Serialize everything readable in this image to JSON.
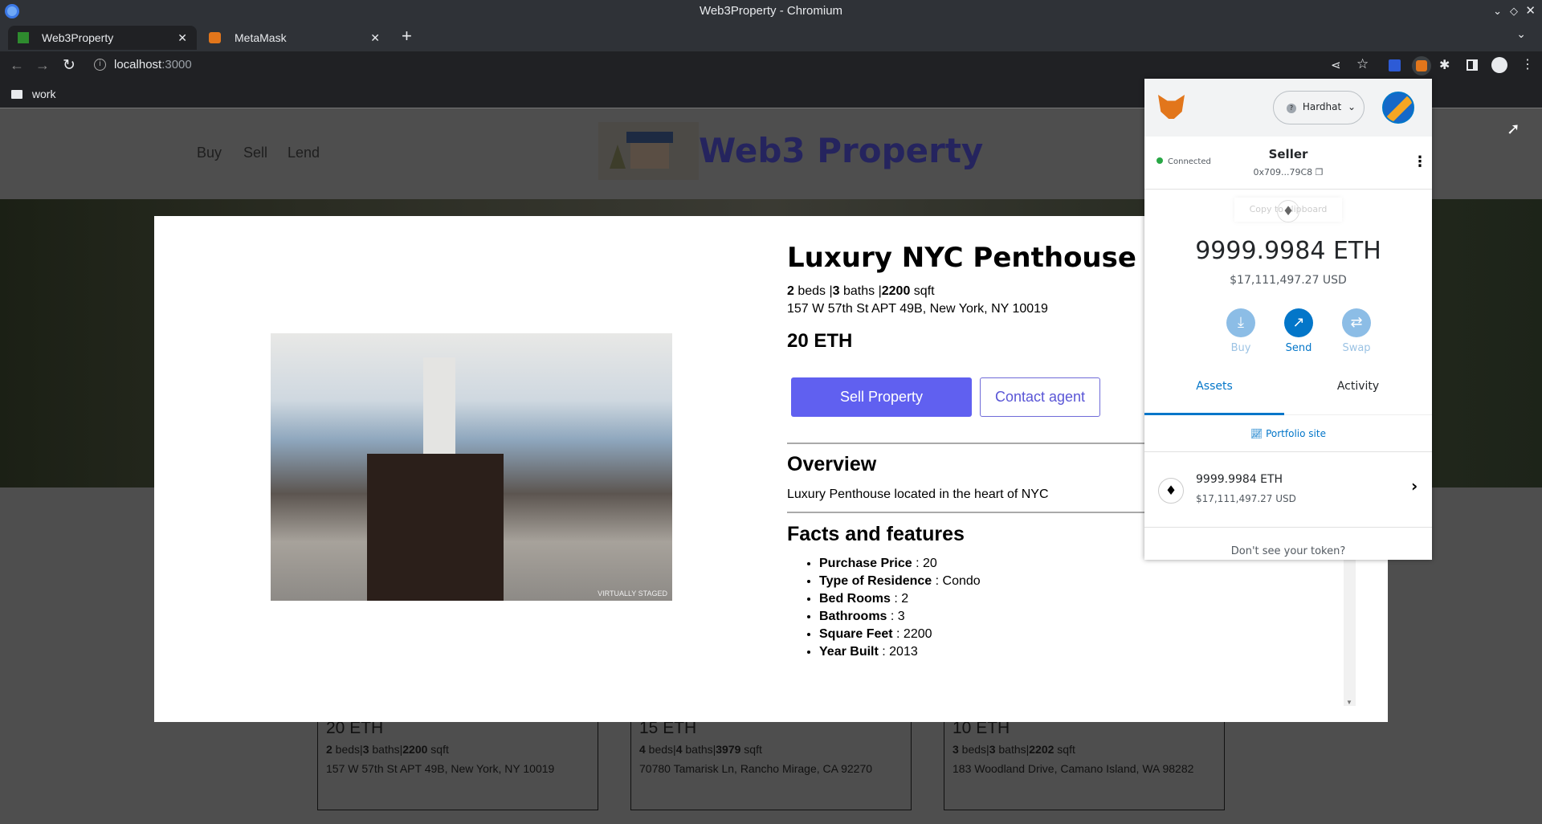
{
  "window_title": "Web3Property - Chromium",
  "tabs": [
    {
      "label": "Web3Property",
      "active": true
    },
    {
      "label": "MetaMask",
      "active": false
    }
  ],
  "address": {
    "host": "localhost",
    "port": ":3000"
  },
  "bookmarks": [
    {
      "label": "work"
    }
  ],
  "nav": {
    "links": [
      "Buy",
      "Sell",
      "Lend"
    ],
    "brand": "Web3 Property",
    "brand_color": "#2b2a80"
  },
  "modal": {
    "title": "Luxury NYC Penthouse",
    "beds": "2",
    "baths": "3",
    "sqft": "2200",
    "beds_label": " beds |",
    "baths_label": " baths |",
    "sqft_label": " sqft",
    "address": "157 W 57th St APT 49B, New York, NY 10019",
    "price": "20 ETH",
    "image_watermark": "VIRTUALLY STAGED",
    "primary_button": "Sell Property",
    "secondary_button": "Contact agent",
    "accent": "#6060f0",
    "overview_heading": "Overview",
    "overview_text": "Luxury Penthouse located in the heart of NYC",
    "facts_heading": "Facts and features",
    "facts": [
      {
        "k": "Purchase Price",
        "v": " : 20"
      },
      {
        "k": "Type of Residence",
        "v": " : Condo"
      },
      {
        "k": "Bed Rooms",
        "v": " : 2"
      },
      {
        "k": "Bathrooms",
        "v": " : 3"
      },
      {
        "k": "Square Feet",
        "v": " : 2200"
      },
      {
        "k": "Year Built",
        "v": " : 2013"
      }
    ]
  },
  "cards": [
    {
      "price": "20 ETH",
      "beds": "2",
      "baths": "3",
      "sqft": "2200",
      "address": "157 W 57th St APT 49B, New York, NY 10019"
    },
    {
      "price": "15 ETH",
      "beds": "4",
      "baths": "4",
      "sqft": "3979",
      "address": "70780 Tamarisk Ln, Rancho Mirage, CA 92270"
    },
    {
      "price": "10 ETH",
      "beds": "3",
      "baths": "3",
      "sqft": "2202",
      "address": "183 Woodland Drive, Camano Island, WA 98282"
    }
  ],
  "card_labels": {
    "beds": " beds",
    "baths": " baths",
    "sqft": " sqft",
    "sep": "|"
  },
  "metamask": {
    "network": "Hardhat",
    "status": "Connected",
    "account_name": "Seller",
    "account_address": "0x709...79C8",
    "tooltip": "Copy to clipboard",
    "balance": "9999.9984 ETH",
    "balance_usd": "$17,111,497.27 USD",
    "actions": [
      {
        "label": "Buy",
        "icon": "download-icon"
      },
      {
        "label": "Send",
        "icon": "arrow-up-right-icon"
      },
      {
        "label": "Swap",
        "icon": "swap-icon"
      }
    ],
    "tabs": [
      {
        "label": "Assets",
        "active": true
      },
      {
        "label": "Activity",
        "active": false
      }
    ],
    "portfolio_link": "Portfolio site",
    "asset": {
      "amount": "9999.9984 ETH",
      "usd": "$17,111,497.27 USD"
    },
    "footer": "Don't see your token?",
    "accent": "#0376c9"
  }
}
